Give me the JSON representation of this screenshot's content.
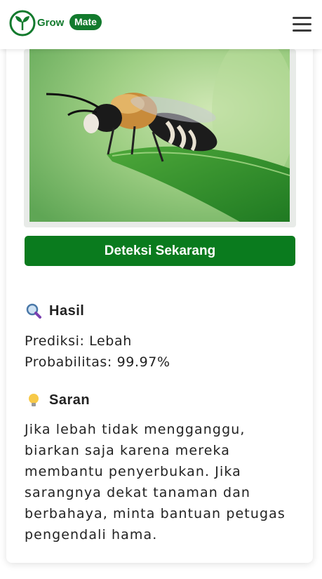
{
  "header": {
    "logo_text_main": "Grow",
    "logo_text_pill": "Mate",
    "logo_icon": "sprout-logo-icon",
    "menu_icon": "hamburger-menu-icon"
  },
  "main": {
    "image_subject": "bee-on-leaf-photo",
    "detect_button_label": "Deteksi Sekarang",
    "result": {
      "icon": "magnifier-icon",
      "title": "Hasil",
      "prediction": "Prediksi: Lebah",
      "probability": "Probabilitas: 99.97%"
    },
    "advice": {
      "icon": "lightbulb-icon",
      "title": "Saran",
      "text": "Jika lebah tidak mengganggu, biarkan saja karena mereka membantu penyerbukan. Jika sarangnya dekat tanaman dan berbahaya, minta bantuan petugas pengendali hama."
    }
  },
  "colors": {
    "brand_green": "#127a2d",
    "button_green": "#0a7b1e"
  }
}
